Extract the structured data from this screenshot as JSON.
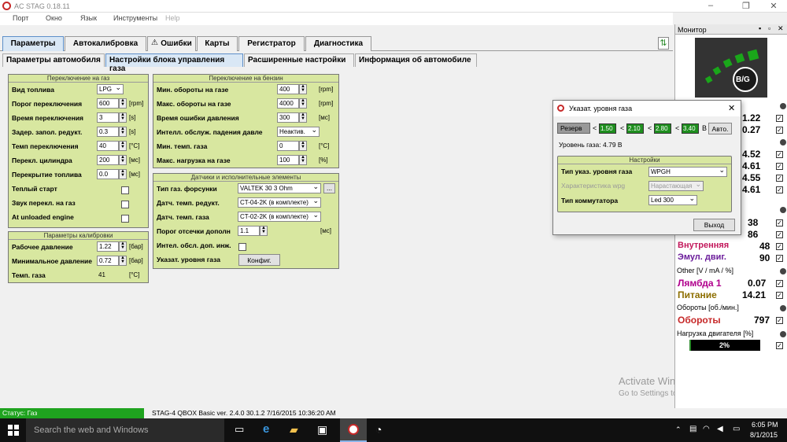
{
  "app": {
    "title": "AC STAG 0.18.11"
  },
  "menu": [
    "Порт",
    "Окно",
    "Язык",
    "Инструменты",
    "Help"
  ],
  "tabs1": [
    "Параметры",
    "Автокалибровка",
    "Ошибки",
    "Карты",
    "Регистратор",
    "Диагностика"
  ],
  "tabs2": [
    "Параметры автомобиля",
    "Настройки блока управления газа",
    "Расширенные настройки",
    "Информация об автомобиле"
  ],
  "switch_gas": {
    "title": "Переключение на газ",
    "fuel_type_label": "Вид топлива",
    "fuel_type": "LPG",
    "rows": [
      {
        "label": "Порог переключения",
        "value": "600",
        "unit": "[rpm]"
      },
      {
        "label": "Время переключения",
        "value": "3",
        "unit": "[s]"
      },
      {
        "label": "Задер. запол. редукт.",
        "value": "0.3",
        "unit": "[s]"
      },
      {
        "label": "Темп переключения",
        "value": "40",
        "unit": "[°C]"
      },
      {
        "label": "Перекл. цилиндра",
        "value": "200",
        "unit": "[мс]"
      },
      {
        "label": "Перекрытие топлива",
        "value": "0.0",
        "unit": "[мс]"
      }
    ],
    "checks": [
      "Теплый старт",
      "Звук перекл. на газ",
      "At unloaded engine"
    ]
  },
  "calib": {
    "title": "Параметры калибровки",
    "rows": [
      {
        "label": "Рабочее давление",
        "value": "1.22",
        "unit": "[бар]"
      },
      {
        "label": "Минимальное давление",
        "value": "0.72",
        "unit": "[бар]"
      }
    ],
    "temp_label": "Темп. газа",
    "temp_value": "41",
    "temp_unit": "[°C]"
  },
  "switch_petrol": {
    "title": "Переключение на бензин",
    "rows": [
      {
        "label": "Мин. обороты на газе",
        "value": "400",
        "unit": "[rpm]"
      },
      {
        "label": "Макс. обороты на газе",
        "value": "4000",
        "unit": "[rpm]"
      },
      {
        "label": "Время ошибки давления",
        "value": "300",
        "unit": "[мс]"
      }
    ],
    "intel_label": "Интелл. обслуж. падения давле",
    "intel_value": "Неактив.",
    "rows2": [
      {
        "label": "Мин. темп. газа",
        "value": "0",
        "unit": "[°C]"
      },
      {
        "label": "Макс. нагрузка на газе",
        "value": "100",
        "unit": "[%]"
      }
    ]
  },
  "sensors": {
    "title": "Датчики и исполнительные элементы",
    "injector_label": "Тип газ. форсунки",
    "injector": "VALTEK 30 3 Ohm",
    "red_temp_label": "Датч. темп. редукт.",
    "red_temp": "CT-04-2K (в комплекте)",
    "gas_temp_label": "Датч. темп. газа",
    "gas_temp": "CT-02-2K (в комплекте)",
    "cutoff_label": "Порог отсечки дополн",
    "cutoff_value": "1.1",
    "cutoff_unit": "[мс]",
    "intel_inj_label": "Интел. обсл. доп. инж.",
    "level_label": "Указат. уровня газа",
    "config_btn": "Конфиг."
  },
  "status": {
    "left": "Статус: Газ",
    "right": "STAG-4 QBOX Basic  ver. 2.4.0  30.1.2  7/16/2015 10:36:20 AM"
  },
  "monitor": {
    "title": "Монитор",
    "switch_label": "B/G",
    "values": [
      "1.22",
      "0.27",
      "4.52",
      "4.61",
      "4.55",
      "4.61",
      "38",
      "86",
      "48",
      "90"
    ],
    "temp_names": [
      "Внутренняя",
      "Эмул. двиг."
    ],
    "other_hdr": "Other [V / mA / %]",
    "lambda_label": "Лямбда 1",
    "lambda_value": "0.07",
    "power_label": "Питание",
    "power_value": "14.21",
    "rpm_hdr": "Обороты [об./мин.]",
    "rpm_label": "Обороты",
    "rpm_value": "797",
    "load_hdr": "Нагрузка двигателя [%]",
    "load_value": "2%",
    "load_fraction": 0.02
  },
  "dialog": {
    "title": "Указат. уровня газа",
    "reserve": "Резерв",
    "levels": [
      "1.50",
      "2.10",
      "2.80",
      "3.40"
    ],
    "unit": "B",
    "auto_btn": "Авто.",
    "level_text": "Уровень газа:  4.79 В",
    "settings_title": "Настройки",
    "type_label": "Тип указ. уровня газа",
    "type_value": "WPGH",
    "char_label": "Характеристика wpg",
    "char_value": "Нарастающая",
    "switch_label": "Тип коммутатора",
    "switch_value": "Led 300",
    "exit_btn": "Выход"
  },
  "watermark": {
    "line1": "Activate Windows",
    "line2": "Go to Settings to activate Windows."
  },
  "taskbar": {
    "search": "Search the web and Windows",
    "time": "6:05 PM",
    "date": "8/1/2015"
  },
  "colors": {
    "panel_green": "#d8e7a0",
    "accent": "#2b8b2b",
    "level_green": "#1f8f1f"
  }
}
